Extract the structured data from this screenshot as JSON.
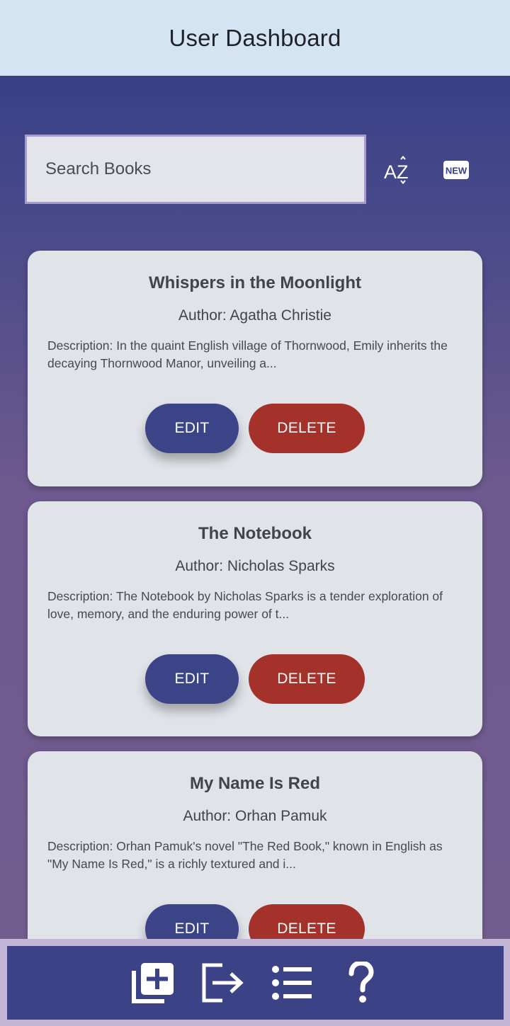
{
  "header": {
    "title": "User Dashboard"
  },
  "search": {
    "placeholder": "Search Books",
    "value": ""
  },
  "toolbar": {
    "sort_icon": "sort-alphabetical-icon",
    "new_icon": "new-badge-icon",
    "new_label": "NEW"
  },
  "books": [
    {
      "title": "Whispers in the Moonlight",
      "author": "Author: Agatha Christie",
      "description": "Description: In the quaint English village of Thornwood, Emily inherits the decaying Thornwood Manor, unveiling a...",
      "edit_label": "EDIT",
      "delete_label": "DELETE"
    },
    {
      "title": "The Notebook",
      "author": "Author: Nicholas Sparks",
      "description": "Description: The Notebook by Nicholas Sparks is a tender exploration of love, memory, and the enduring power of t...",
      "edit_label": "EDIT",
      "delete_label": "DELETE"
    },
    {
      "title": "My Name Is Red",
      "author": "Author: Orhan Pamuk",
      "description": "Description: Orhan Pamuk's novel \"The Red Book,\" known in English as \"My Name Is Red,\" is a richly textured and i...",
      "edit_label": "EDIT",
      "delete_label": "DELETE"
    }
  ],
  "bottom_nav": [
    {
      "icon": "add-library-icon"
    },
    {
      "icon": "logout-icon"
    },
    {
      "icon": "list-icon"
    },
    {
      "icon": "help-icon"
    }
  ],
  "colors": {
    "header_bg": "#d5e4f2",
    "card_bg": "#e0e3e8",
    "edit_button": "#3a4487",
    "delete_button": "#a4322b",
    "bottom_bar": "#3b4286"
  }
}
